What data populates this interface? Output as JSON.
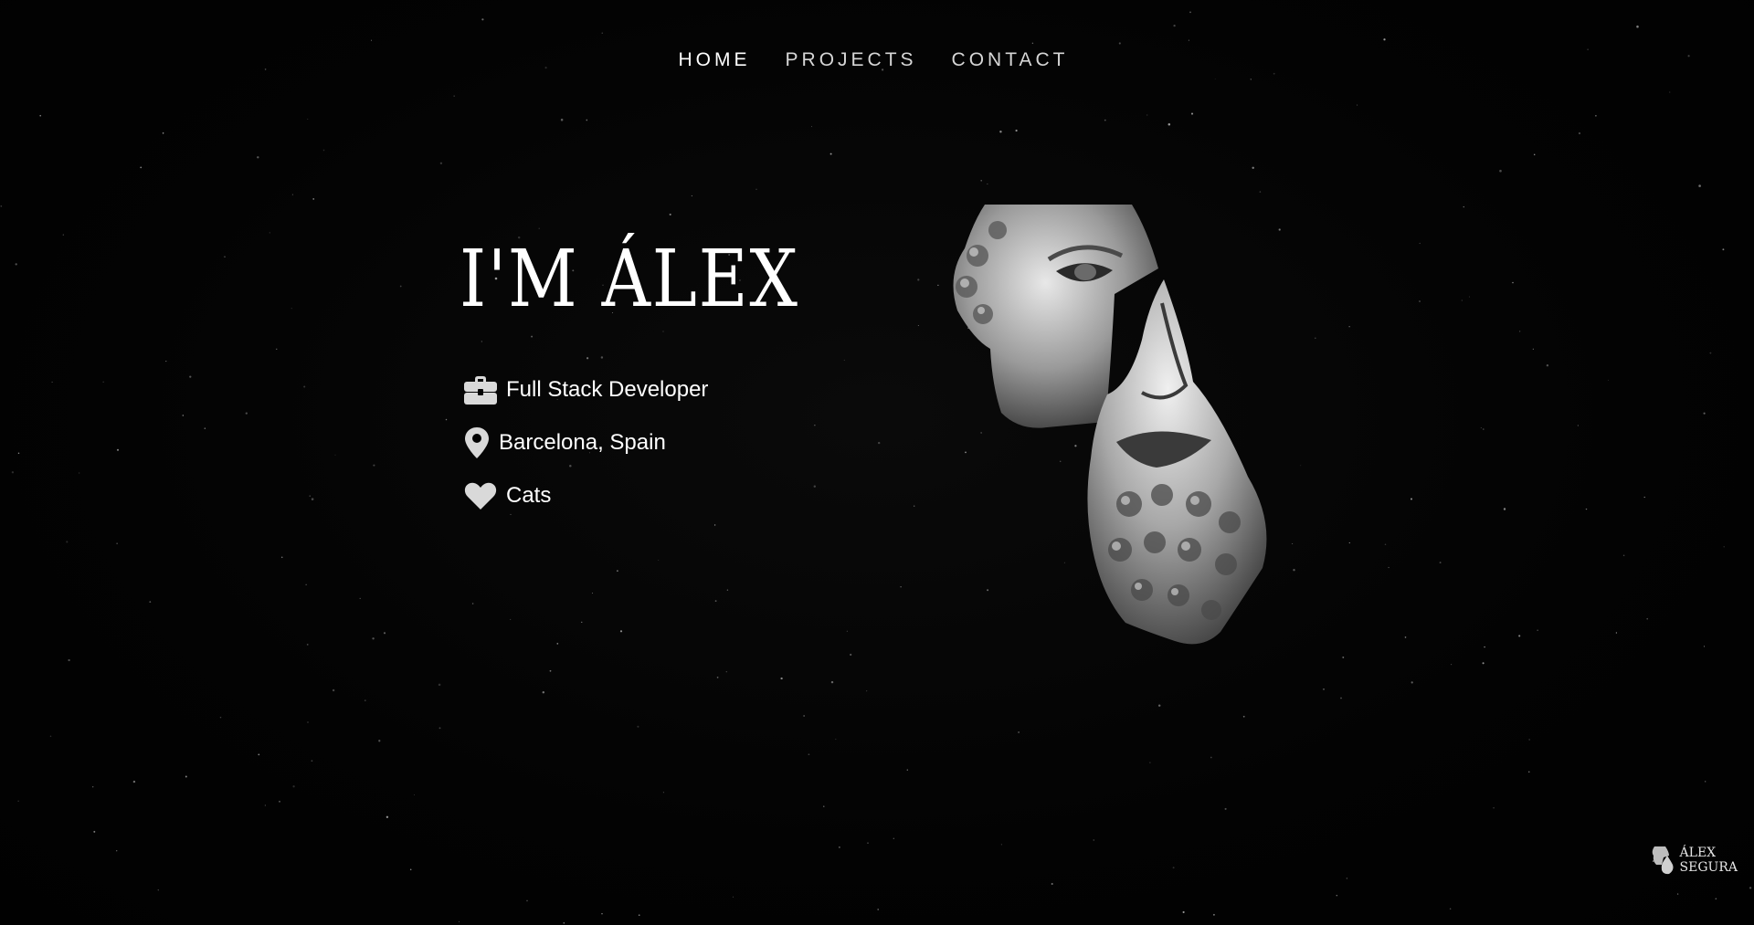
{
  "nav": {
    "items": [
      {
        "label": "HOME",
        "active": true
      },
      {
        "label": "PROJECTS",
        "active": false
      },
      {
        "label": "CONTACT",
        "active": false
      }
    ]
  },
  "hero": {
    "title": "I'M ÁLEX"
  },
  "info": {
    "items": [
      {
        "icon": "briefcase-icon",
        "text": "Full Stack Developer"
      },
      {
        "icon": "map-pin-icon",
        "text": "Barcelona, Spain"
      },
      {
        "icon": "heart-icon",
        "text": "Cats"
      }
    ]
  },
  "logo": {
    "line1": "ÁLEX",
    "line2": "SEGURA"
  },
  "colors": {
    "background": "#030303",
    "text": "#ffffff",
    "nav_text": "#d6d6d6",
    "icon": "#d9d9d9"
  }
}
